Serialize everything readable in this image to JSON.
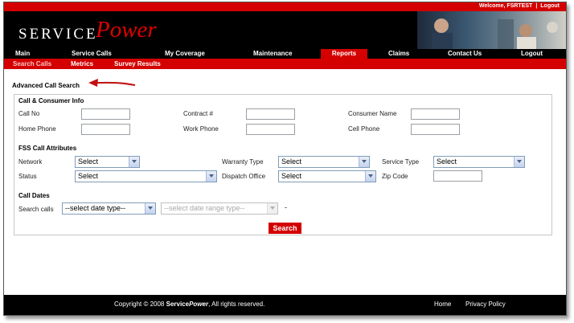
{
  "header": {
    "welcome": "Welcome, FSRTEST",
    "separator": "|",
    "logout": "Logout",
    "logo_service": "SERVICE",
    "logo_power": "Power"
  },
  "main_nav": [
    "Main",
    "Service Calls",
    "My Coverage",
    "Maintenance",
    "Reports",
    "Claims",
    "Contact Us",
    "Logout"
  ],
  "active_main_nav": "Reports",
  "sub_nav": [
    "Search Calls",
    "Metrics",
    "Survey Results"
  ],
  "active_sub_nav": "Search Calls",
  "page_title": "Advanced Call Search",
  "consumer_section": {
    "title": "Call & Consumer Info",
    "fields": {
      "call_no": {
        "label": "Call No",
        "value": ""
      },
      "contract": {
        "label": "Contract #",
        "value": ""
      },
      "consumer_name": {
        "label": "Consumer Name",
        "value": ""
      },
      "home_phone": {
        "label": "Home Phone",
        "value": ""
      },
      "work_phone": {
        "label": "Work Phone",
        "value": ""
      },
      "cell_phone": {
        "label": "Cell Phone",
        "value": ""
      }
    }
  },
  "fss_section": {
    "title": "FSS Call Attributes",
    "network": {
      "label": "Network",
      "value": "Select"
    },
    "warranty_type": {
      "label": "Warranty Type",
      "value": "Select"
    },
    "service_type": {
      "label": "Service Type",
      "value": "Select"
    },
    "status": {
      "label": "Status",
      "value": "Select"
    },
    "dispatch_office": {
      "label": "Dispatch Office",
      "value": "Select"
    },
    "zip_code": {
      "label": "Zip Code",
      "value": ""
    }
  },
  "dates_section": {
    "title": "Call Dates",
    "search_label": "Search calls",
    "date_type": "--select date type--",
    "date_range": "--select date range type--",
    "dash": "-"
  },
  "search_button": "Search",
  "footer": {
    "copyright_prefix": "Copyright © 2008",
    "brand_service": "Service",
    "brand_power": "Power",
    "copyright_suffix": ", All rights reserved.",
    "home": "Home",
    "privacy": "Privacy Policy"
  },
  "colors": {
    "accent_red": "#d40000",
    "nav_black": "#000000",
    "arrow": "#c01010"
  }
}
